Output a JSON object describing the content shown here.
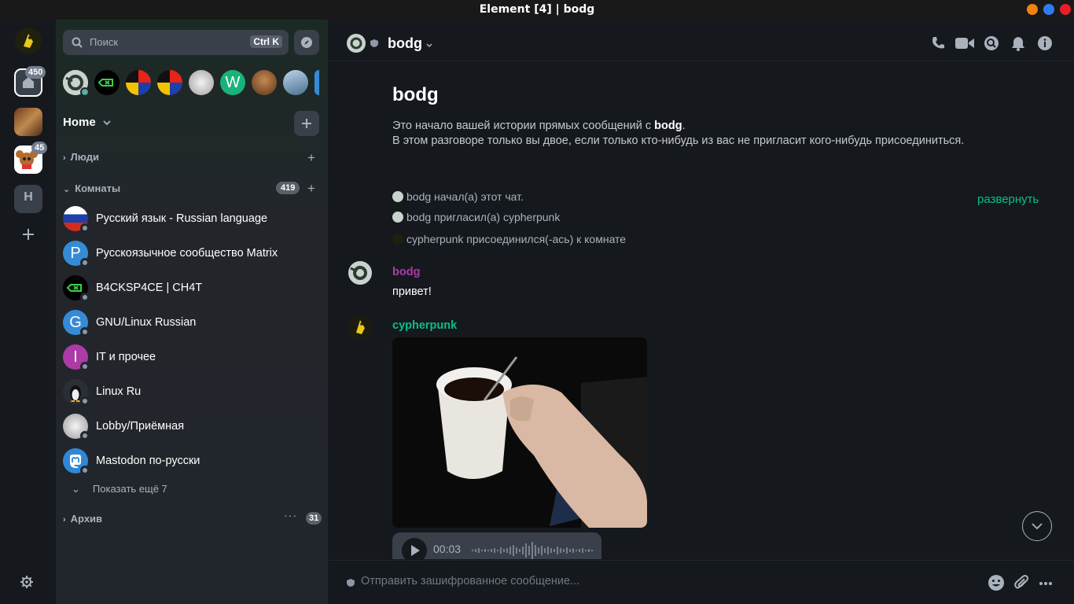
{
  "window": {
    "title": "Element [4] | bodg"
  },
  "spaces": {
    "home_badge": "450",
    "space3_badge": "45",
    "space4_letter": "H"
  },
  "search": {
    "placeholder": "Поиск",
    "shortcut": "Ctrl K"
  },
  "roomlist": {
    "home_label": "Home",
    "people_label": "Люди",
    "rooms_label": "Комнаты",
    "rooms_count": "419",
    "rooms": [
      {
        "name": "Русский язык - Russian language",
        "avatar": "russian-flag"
      },
      {
        "name": "Русскоязычное сообщество Matrix",
        "avatar_letter": "Р",
        "color": "#368bd6"
      },
      {
        "name": "B4CKSP4CE | CH4T",
        "avatar": "backspace-icon"
      },
      {
        "name": "GNU/Linux Russian",
        "avatar_letter": "G",
        "color": "#368bd6"
      },
      {
        "name": "IT и прочее",
        "avatar_letter": "I",
        "color": "#ac3ba8"
      },
      {
        "name": "Linux Ru",
        "avatar": "tux-icon"
      },
      {
        "name": "Lobby/Приёмная",
        "avatar": "lobby"
      },
      {
        "name": "Mastodon по-русски",
        "avatar": "mastodon-icon"
      }
    ],
    "show_more": "Показать ещё 7",
    "archive_label": "Архив",
    "archive_count": "31"
  },
  "header": {
    "room_name": "bodg"
  },
  "timeline": {
    "intro_title": "bodg",
    "intro_line1_prefix": "Это начало вашей истории прямых сообщений с ",
    "intro_line1_name": "bodg",
    "intro_line1_suffix": ".",
    "intro_line2": "В этом разговоре только вы двое, если только кто-нибудь из вас не пригласит кого-нибудь присоединиться.",
    "events": [
      "bodg начал(а) этот чат.",
      "bodg пригласил(а) cypherpunk",
      "cypherpunk присоединился(-ась) к комнате"
    ],
    "expand_label": "развернуть",
    "messages": [
      {
        "sender": "bodg",
        "sender_color": "#ac3ba8",
        "body": "привет!"
      },
      {
        "sender": "cypherpunk",
        "sender_color": "#0dbd8b",
        "body": ""
      }
    ],
    "voice_time": "00:03"
  },
  "composer": {
    "placeholder": "Отправить зашифрованное сообщение..."
  },
  "colors": {
    "accent": "#0dbd8b",
    "bg": "#15191e",
    "panel": "#21262c"
  }
}
